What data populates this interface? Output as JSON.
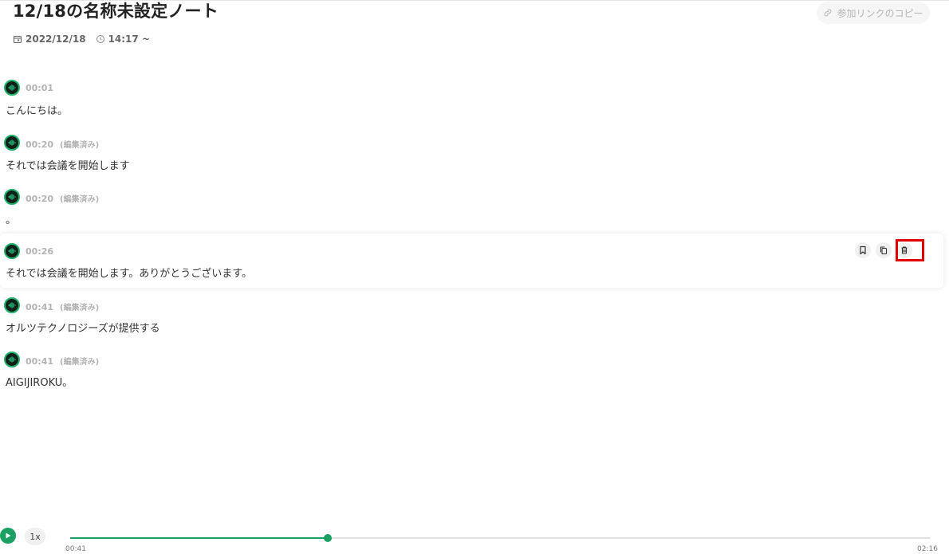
{
  "note": {
    "title": "12/18の名称未設定ノート",
    "date": "2022/12/18",
    "time": "14:17 ~",
    "copy_link_label": "参加リンクのコピー"
  },
  "messages": [
    {
      "time": "00:01",
      "edited": "",
      "text": "こんにちは。"
    },
    {
      "time": "00:20",
      "edited": "(編集済み)",
      "text": "それでは会議を開始します"
    },
    {
      "time": "00:20",
      "edited": "(編集済み)",
      "text": "。"
    },
    {
      "time": "00:26",
      "edited": "",
      "text": "それでは会議を開始します。ありがとうございます。"
    },
    {
      "time": "00:41",
      "edited": "(編集済み)",
      "text": "オルツテクノロジーズが提供する"
    },
    {
      "time": "00:41",
      "edited": "(編集済み)",
      "text": "AIGIJIROKU。"
    }
  ],
  "actions": {
    "bookmark_icon": "bookmark-icon",
    "copy_icon": "copy-icon",
    "delete_icon": "trash-icon"
  },
  "player": {
    "speed": "1x",
    "current_time": "00:41",
    "duration": "02:16",
    "progress": 0.3
  },
  "colors": {
    "accent": "#1aa063",
    "highlight": "#e00000"
  }
}
